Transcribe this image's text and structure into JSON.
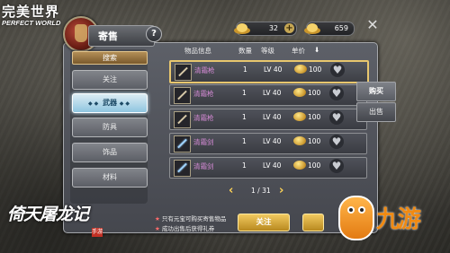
{
  "app_logo": {
    "cn": "完美世界",
    "en": "PERFECT WORLD"
  },
  "window": {
    "title": "寄售",
    "help": "?",
    "close": "✕"
  },
  "resources": [
    {
      "icon": "gold-ingot-icon",
      "value": "32",
      "plus": "+"
    },
    {
      "icon": "gold-ingot-icon",
      "value": "659"
    }
  ],
  "sidebar": {
    "search_label": "搜索",
    "items": [
      {
        "label": "关注",
        "active": false
      },
      {
        "label": "武器",
        "active": true
      },
      {
        "label": "防具",
        "active": false
      },
      {
        "label": "饰品",
        "active": false
      },
      {
        "label": "材料",
        "active": false
      }
    ]
  },
  "table": {
    "columns": [
      "物品信息",
      "数量",
      "等级",
      "单价"
    ],
    "rows": [
      {
        "name": "清霜枪",
        "qty": "1",
        "level": "LV 40",
        "price": "100",
        "icon": "spear-icon",
        "selected": true
      },
      {
        "name": "清霜枪",
        "qty": "1",
        "level": "LV 40",
        "price": "100",
        "icon": "spear-icon",
        "selected": false
      },
      {
        "name": "清霜枪",
        "qty": "1",
        "level": "LV 40",
        "price": "100",
        "icon": "spear-icon",
        "selected": false
      },
      {
        "name": "清霜剑",
        "qty": "1",
        "level": "LV 40",
        "price": "100",
        "icon": "sword-icon",
        "selected": false
      },
      {
        "name": "清霜剑",
        "qty": "1",
        "level": "LV 40",
        "price": "100",
        "icon": "sword-icon",
        "selected": false
      }
    ]
  },
  "side_tabs": [
    {
      "label": "购买",
      "active": true
    },
    {
      "label": "出售",
      "active": false
    }
  ],
  "pager": {
    "prev": "‹",
    "text": "1 / 31",
    "next": "›"
  },
  "notes": [
    "只有元宝可购买寄售物品",
    "成功出售后获得礼券"
  ],
  "follow_button": "关注",
  "game_logo": {
    "text": "倚天屠龙记",
    "mark": "手游"
  },
  "brand": {
    "text": "九游"
  }
}
